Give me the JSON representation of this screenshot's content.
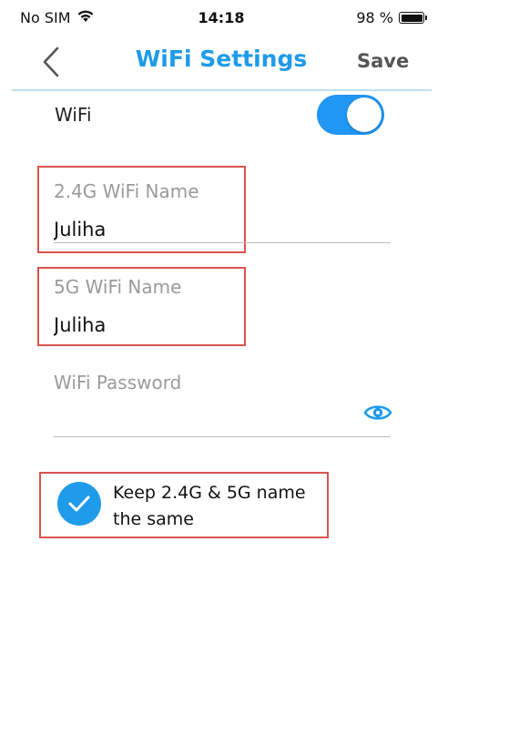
{
  "status_bar": {
    "carrier": "No SIM",
    "time": "14:18",
    "battery": "98 %"
  },
  "nav": {
    "title": "WiFi Settings",
    "save_label": "Save",
    "title_color": "#1e9be9"
  },
  "wifi": {
    "label": "WiFi",
    "enabled": true
  },
  "fields": {
    "name_24g": {
      "label": "2.4G WiFi Name",
      "value": "Juliha"
    },
    "name_5g": {
      "label": "5G WiFi Name",
      "value": "Juliha"
    },
    "password": {
      "label": "WiFi Password",
      "value": ""
    }
  },
  "same_name": {
    "label": "Keep 2.4G & 5G name the same",
    "checked": true
  },
  "colors": {
    "accent": "#1e9be9",
    "highlight": "#d9534f"
  }
}
